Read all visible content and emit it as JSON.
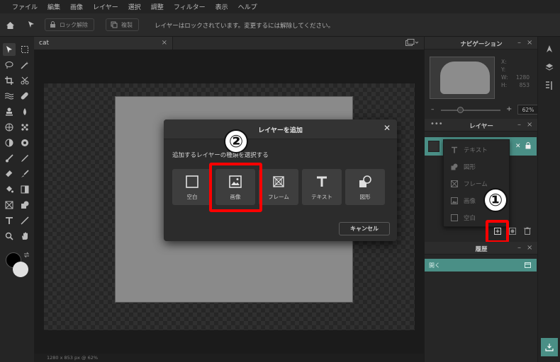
{
  "menu": [
    "ファイル",
    "編集",
    "画像",
    "レイヤー",
    "選択",
    "調整",
    "フィルター",
    "表示",
    "ヘルプ"
  ],
  "toolbar": {
    "unlock_label": "ロック解除",
    "duplicate_label": "複製",
    "message": "レイヤーはロックされています。変更するには解除してください。"
  },
  "document": {
    "tab_name": "cat",
    "close": "×",
    "status": "1280 x 853 px @ 62%"
  },
  "navigation": {
    "title": "ナビゲーション",
    "x_label": "X:",
    "y_label": "Y:",
    "w_label": "W:",
    "w_value": "1280",
    "h_label": "H:",
    "h_value": "853",
    "zoom": "62%",
    "minimize": "–",
    "close": "×"
  },
  "layers": {
    "title": "レイヤー",
    "dots": "•••",
    "minimize": "–",
    "close": "×",
    "add_menu": [
      "テキスト",
      "図形",
      "フレーム",
      "画像",
      "空白"
    ]
  },
  "history": {
    "title": "履歴",
    "minimize": "–",
    "close": "×",
    "item": "開く"
  },
  "dialog": {
    "title": "レイヤーを追加",
    "close": "✕",
    "prompt": "追加するレイヤーの種類を選択する",
    "choices": [
      "空白",
      "画像",
      "フレーム",
      "テキスト",
      "図形"
    ],
    "cancel": "キャンセル"
  },
  "annotations": {
    "step1": "①",
    "step2": "②"
  },
  "colors": {
    "accent": "#4a8f86",
    "highlight": "#ff0000",
    "bg": "#1e1e1e"
  }
}
